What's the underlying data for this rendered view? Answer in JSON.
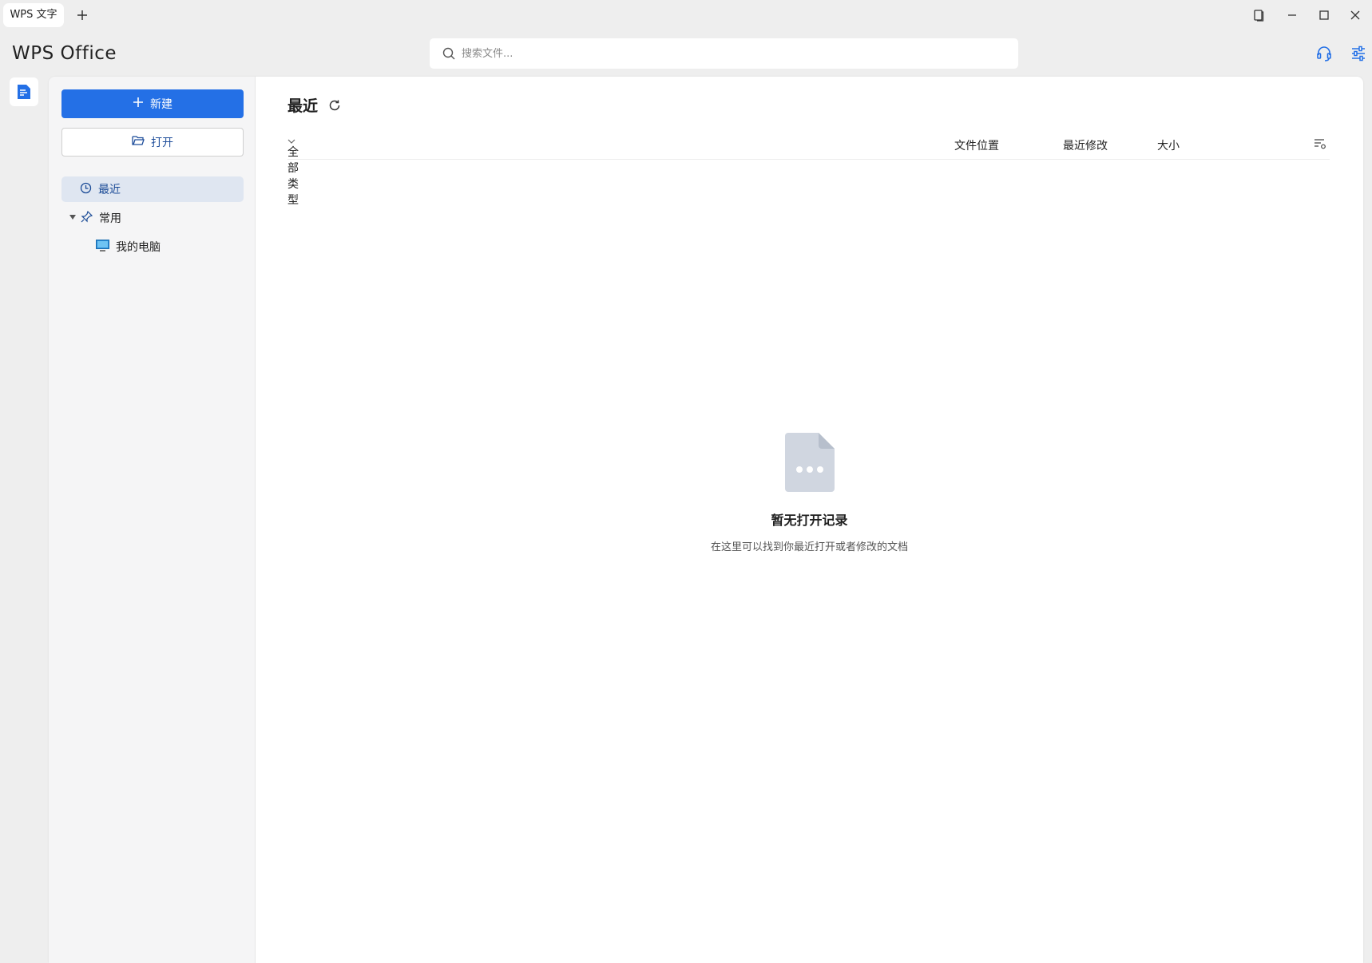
{
  "window": {
    "tab_label": "WPS 文字",
    "icons": [
      "add-tab-icon",
      "restore-window-icon",
      "minimize-icon",
      "maximize-icon",
      "close-icon"
    ]
  },
  "header": {
    "logo": "WPS Office",
    "search_placeholder": "搜索文件...",
    "icons": [
      "headset-support-icon",
      "settings-sliders-icon"
    ]
  },
  "sidebar": {
    "new_button": "新建",
    "open_button": "打开",
    "nav": [
      {
        "label": "最近",
        "icon": "clock-icon",
        "active": true
      },
      {
        "label": "常用",
        "icon": "pin-icon",
        "expanded": true
      },
      {
        "label": "我的电脑",
        "icon": "monitor-icon"
      }
    ]
  },
  "main": {
    "title": "最近",
    "filter_label": "全部类型",
    "columns": [
      "文件位置",
      "最近修改",
      "大小"
    ],
    "empty_title": "暂无打开记录",
    "empty_desc": "在这里可以找到你最近打开或者修改的文档"
  },
  "colors": {
    "primary": "#2470e6",
    "active_nav_bg": "#dfe6f1",
    "active_nav_text": "#1a4a96",
    "app_bg": "#eeeeee",
    "empty_icon": "#d0d6e0"
  }
}
